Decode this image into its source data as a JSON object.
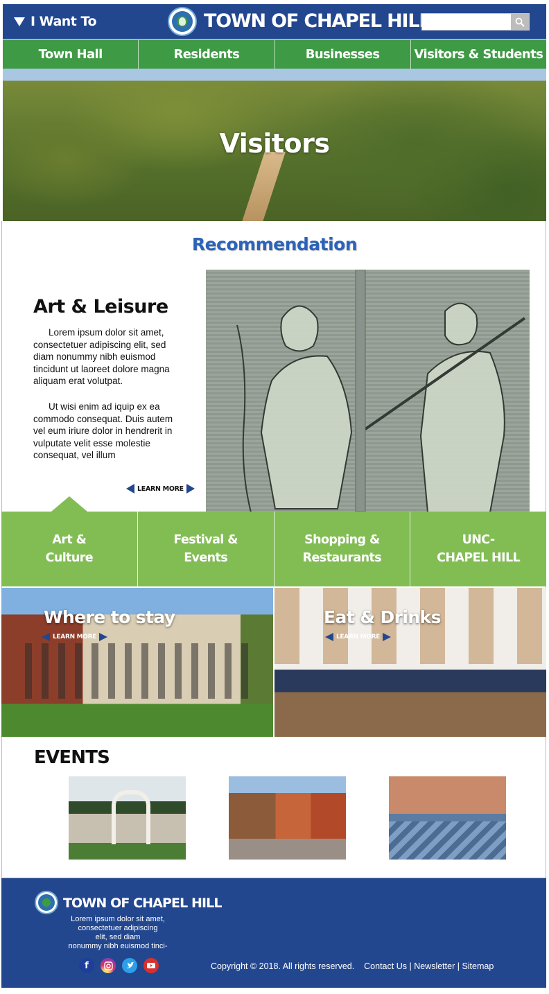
{
  "header": {
    "menu_label": "I Want To",
    "site_title": "TOWN OF CHAPEL HILL",
    "search_placeholder": ""
  },
  "main_nav": [
    "Town Hall",
    "Residents",
    "Businesses",
    "Visitors & Students"
  ],
  "hero": {
    "title": "Visitors"
  },
  "recommendation": {
    "heading": "Recommendation",
    "feature_title": "Art & Leisure",
    "paragraph_1": "Lorem ipsum dolor sit amet, consectetuer adipiscing elit, sed diam nonummy nibh euismod tincidunt ut laoreet dolore magna aliquam erat volutpat.",
    "paragraph_2": "Ut wisi enim ad iquip ex ea commodo consequat. Duis autem vel eum iriure dolor in hendrerit in vulputate velit esse molestie consequat, vel illum",
    "learn_more": "LEARN MORE"
  },
  "categories": [
    "Art &\nCulture",
    "Festival &\nEvents",
    "Shopping &\nRestaurants",
    "UNC-\nCHAPEL HILL"
  ],
  "tiles": [
    {
      "title": "Where to stay",
      "link": "LEARN MORE"
    },
    {
      "title": "Eat & Drinks",
      "link": "LEARN MORE"
    }
  ],
  "events": {
    "heading": "EVENTS"
  },
  "footer": {
    "title": "TOWN OF CHAPEL HILL",
    "text": "Lorem ipsum dolor sit amet,\nconsectetuer adipiscing\nelit, sed diam\nnonummy nibh euismod tinci-",
    "social": [
      "f",
      "",
      "",
      ""
    ],
    "copyright": "Copyright © 2018.  All rights reserved.",
    "links": [
      "Contact Us",
      "Newsletter",
      "Sitemap"
    ]
  },
  "colors": {
    "brand_blue": "#23478f",
    "nav_green": "#3e9a45",
    "tab_green": "#82bd54",
    "heading_blue": "#2b63b8"
  }
}
